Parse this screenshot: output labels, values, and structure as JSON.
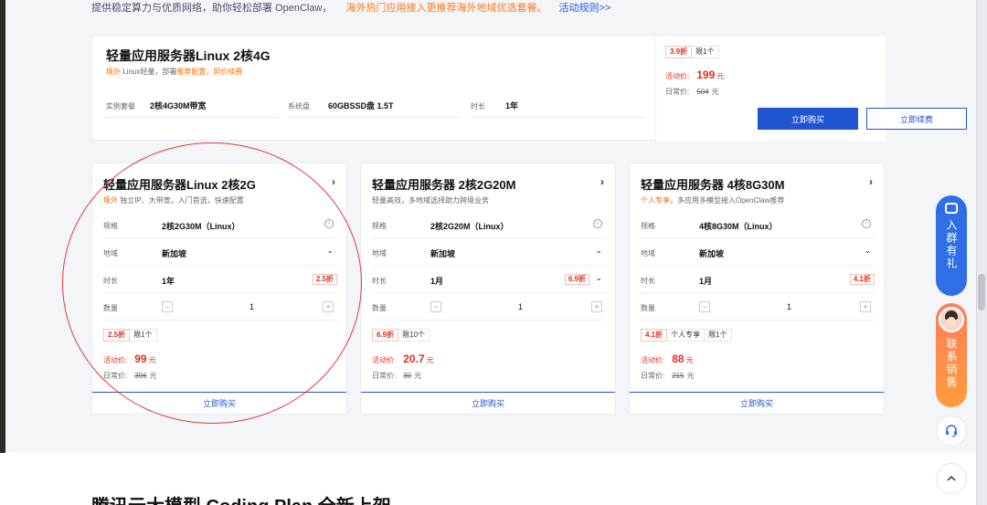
{
  "top_line": {
    "text": "提供稳定算力与优质网络，助你轻松部署 OpenClaw，",
    "promo": "海外热门应用接入更推荐海外地域优选套餐。",
    "link": "活动规则>>"
  },
  "top_card": {
    "title": "轻量应用服务器Linux 2核4G",
    "sub_prefix": "境外",
    "sub_mid": " Linux轻量，部署",
    "sub_promo": "推荐配置，同价续费",
    "specs": [
      {
        "label": "实例套餐",
        "value": "2核4G30M带宽"
      },
      {
        "label": "系统盘",
        "value": "60GBSSD盘 1.5T"
      },
      {
        "label": "时长",
        "value": "1年"
      }
    ],
    "badge_discount": "3.9折",
    "badge_limit": "限1个",
    "price_label": "活动价:",
    "price": "199",
    "price_unit": "元",
    "orig_label": "日常价:",
    "orig_price": "504",
    "orig_unit": "元",
    "buy_label": "立即购买",
    "renew_label": "立即续费"
  },
  "labels": {
    "spec": "规格",
    "region": "地域",
    "duration": "时长",
    "quantity": "数量",
    "price_label": "活动价:",
    "orig_label": "日常价:",
    "unit": "元",
    "buy": "立即购买",
    "minus": "−",
    "plus": "+"
  },
  "cards": [
    {
      "title": "轻量应用服务器Linux 2核2G",
      "sub_tag": "境外",
      "sub_text": " 独立IP、大带宽，入门首选，快速配置",
      "spec": "2核2G30M（Linux）",
      "region": "新加坡",
      "duration": "1年",
      "duration_discount": "2.5折",
      "quantity": "1",
      "badges": [
        "2.5折",
        "限1个"
      ],
      "price": "99",
      "orig_price": "396"
    },
    {
      "title": "轻量应用服务器 2核2G20M",
      "sub_tag": "",
      "sub_text": "轻量高效，多地域选择助力跨境业务",
      "spec": "2核2G20M（Linux）",
      "region": "新加坡",
      "duration": "1月",
      "duration_discount": "6.9折",
      "quantity": "1",
      "badges": [
        "6.9折",
        "限10个"
      ],
      "price": "20.7",
      "orig_price": "30"
    },
    {
      "title": "轻量应用服务器 4核8G30M",
      "sub_tag": "个人专享",
      "sub_text": "，多应用多模型接入OpenClaw推荐",
      "spec": "4核8G30M（Linux）",
      "region": "新加坡",
      "duration": "1月",
      "duration_discount": "4.1折",
      "quantity": "1",
      "badges": [
        "4.1折",
        "个人专享",
        "限1个"
      ],
      "price": "88",
      "orig_price": "215"
    }
  ],
  "float": {
    "join": "入群有礼",
    "sales": "联系销售",
    "support_icon": "headset-icon",
    "top_icon": "chevron-up-icon"
  },
  "bottom_title": "腾讯云大模型 Coding Plan 全新上架"
}
